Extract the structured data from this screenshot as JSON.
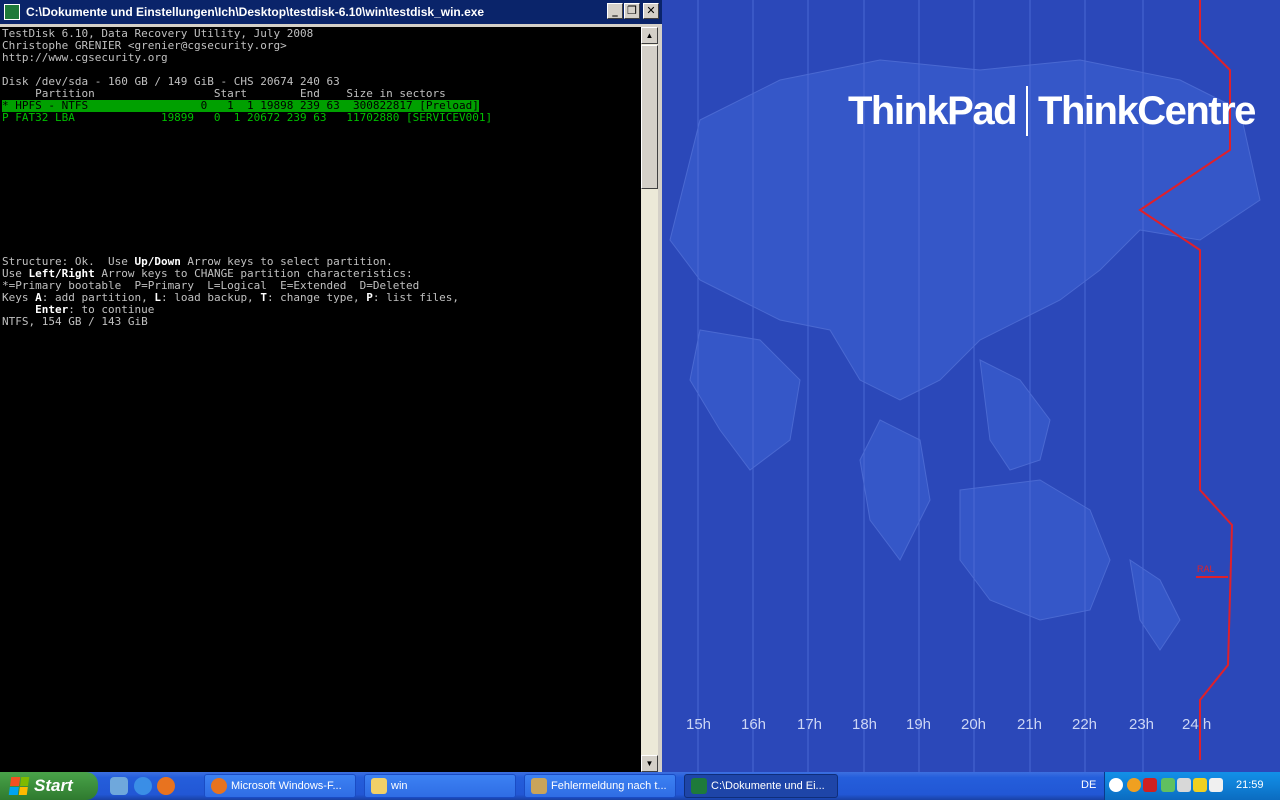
{
  "window": {
    "title": "C:\\Dokumente und Einstellungen\\Ich\\Desktop\\testdisk-6.10\\win\\testdisk_win.exe",
    "buttons": {
      "minimize": "_",
      "maximize": "❐",
      "close": "✕"
    }
  },
  "console": {
    "header": [
      "TestDisk 6.10, Data Recovery Utility, July 2008",
      "Christophe GRENIER <grenier@cgsecurity.org>",
      "http://www.cgsecurity.org"
    ],
    "disk_line": "Disk /dev/sda - 160 GB / 149 GiB - CHS 20674 240 63",
    "table_header": "     Partition                  Start        End    Size in sectors",
    "partitions": [
      "* HPFS - NTFS                 0   1  1 19898 239 63  300822817 [Preload]",
      "P FAT32 LBA             19899   0  1 20672 239 63   11702880 [SERVICEV001]"
    ],
    "help": {
      "l1_a": "Structure: Ok.  Use ",
      "l1_b": "Up/Down",
      "l1_c": " Arrow keys to select partition.",
      "l2_a": "Use ",
      "l2_b": "Left/Right",
      "l2_c": " Arrow keys to CHANGE partition characteristics:",
      "l3": "*=Primary bootable  P=Primary  L=Logical  E=Extended  D=Deleted",
      "l4_a": "Keys ",
      "l4_b": "A",
      "l4_c": ": add partition, ",
      "l4_d": "L",
      "l4_e": ": load backup, ",
      "l4_f": "T",
      "l4_g": ": change type, ",
      "l4_h": "P",
      "l4_i": ": list files,",
      "l5_a": "     ",
      "l5_b": "Enter",
      "l5_c": ": to continue",
      "l6": "NTFS, 154 GB / 143 GiB"
    }
  },
  "wallpaper": {
    "brand_left": "ThinkPad",
    "brand_right": "ThinkCentre",
    "hours": [
      "15h",
      "16h",
      "17h",
      "18h",
      "19h",
      "20h",
      "21h",
      "22h",
      "23h",
      "24 h"
    ],
    "marker": "RAL"
  },
  "taskbar": {
    "start_label": "Start",
    "tasks": [
      "Microsoft Windows-F...",
      "win",
      "Fehlermeldung nach t...",
      "C:\\Dokumente und Ei..."
    ],
    "language": "DE",
    "clock": "21:59"
  },
  "colors": {
    "desktop": "#2b48b9",
    "titlebar": "#0a246a",
    "console_bg": "#000000",
    "console_text": "#c0c0c0",
    "selection": "#00a000",
    "red_line": "#e0202a"
  }
}
